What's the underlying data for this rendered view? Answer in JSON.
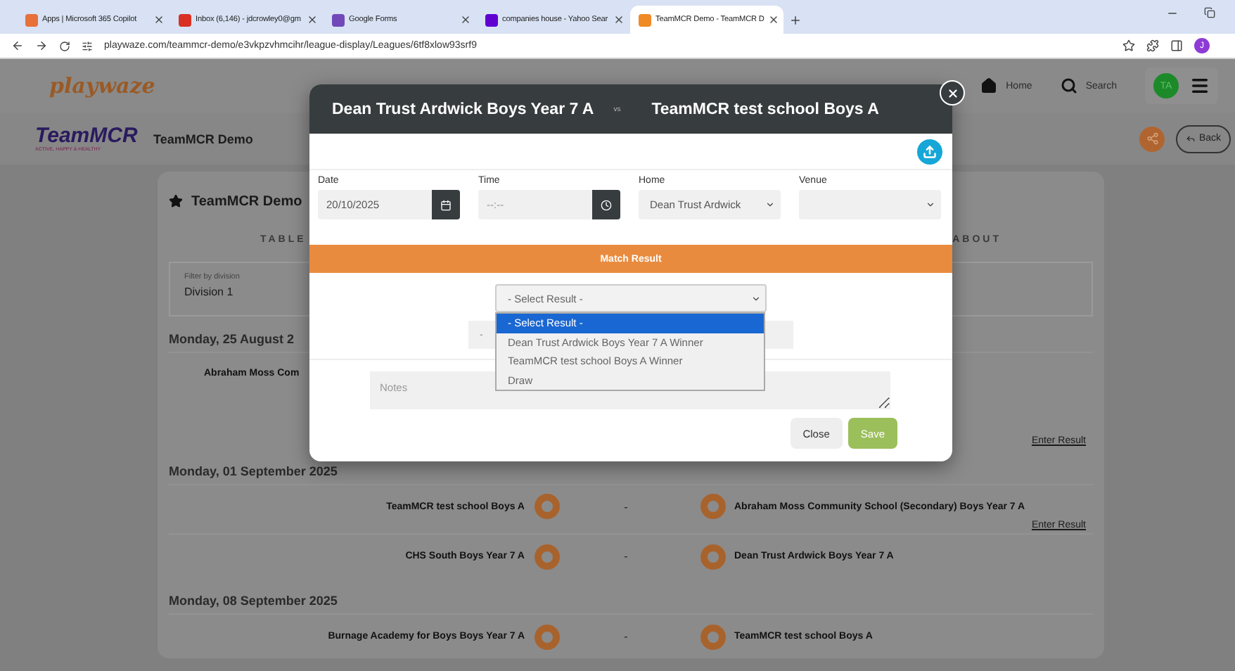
{
  "browser": {
    "tabs": [
      {
        "title": "Apps | Microsoft 365 Copilot",
        "color": "#e8703a",
        "selected": false
      },
      {
        "title": "Inbox (6,146) - jdcrowley0@gm",
        "color": "#d93025",
        "selected": false
      },
      {
        "title": "Google Forms",
        "color": "#7248b9",
        "selected": false
      },
      {
        "title": "companies house - Yahoo Sear",
        "color": "#6001d2",
        "selected": false
      },
      {
        "title": "TeamMCR Demo - TeamMCR D",
        "color": "#f08a24",
        "selected": true
      }
    ],
    "url": "playwaze.com/teammcr-demo/e3vkpzvhmcihr/league-display/Leagues/6tf8xlow93srf9",
    "profile": "J"
  },
  "site_header": {
    "logo": "playwaze",
    "nav": [
      {
        "kind": "home",
        "label": "Home"
      },
      {
        "kind": "search",
        "label": "Search"
      }
    ],
    "avatar": "TA"
  },
  "league_header": {
    "logo": "TeamMCR",
    "tagline": "ACTIVE, HAPPY & HEALTHY",
    "title": "TeamMCR Demo",
    "back": "Back"
  },
  "card": {
    "title": "TeamMCR Demo",
    "tabs": [
      {
        "label": "TABLE"
      },
      {
        "label": "ABOUT"
      }
    ],
    "filter": {
      "label": "Filter by division",
      "value": "Division 1"
    },
    "sections": [
      {
        "date": "Monday, 25 August 2",
        "fixtures": [
          {
            "kind": "covered",
            "home": "Abraham Moss Com"
          },
          {
            "kind": "covered",
            "link": "Enter Result"
          }
        ]
      },
      {
        "date": "Monday, 01 September 2025",
        "fixtures": [
          {
            "kind": "match",
            "home": "TeamMCR test school Boys A",
            "score": "-",
            "away": "Abraham Moss Community School (Secondary) Boys Year 7 A",
            "link": "Enter Result"
          },
          {
            "kind": "match",
            "home": "CHS South Boys Year 7 A",
            "score": "-",
            "away": "Dean Trust Ardwick Boys Year 7 A"
          }
        ]
      },
      {
        "date": "Monday, 08 September 2025",
        "fixtures": [
          {
            "kind": "match",
            "home": "Burnage Academy for Boys Boys Year 7 A",
            "score": "-",
            "away": "TeamMCR test school Boys A"
          }
        ]
      }
    ]
  },
  "modal": {
    "home_team": "Dean Trust Ardwick Boys Year 7 A",
    "vs": "vs",
    "away_team": "TeamMCR test school Boys A",
    "fields": [
      {
        "kind": "date",
        "label": "Date",
        "value": "20/10/2025"
      },
      {
        "kind": "time",
        "label": "Time",
        "placeholder": "--:--"
      },
      {
        "kind": "select",
        "label": "Home",
        "value": "Dean Trust Ardwick"
      },
      {
        "kind": "select",
        "label": "Venue"
      }
    ],
    "section_title": "Match Result",
    "result_select": {
      "value": "- Select Result -",
      "expanded": true,
      "options": [
        {
          "label": "- Select Result -",
          "selected": true
        },
        {
          "label": "Dean Trust Ardwick Boys Year 7 A Winner",
          "selected": false
        },
        {
          "label": "TeamMCR test school Boys A Winner",
          "selected": false
        },
        {
          "label": "Draw",
          "selected": false
        }
      ]
    },
    "score_row": {
      "text": "-"
    },
    "notes": {
      "placeholder": "Notes"
    },
    "buttons": [
      {
        "kind": "secondary",
        "label": "Close"
      },
      {
        "kind": "primary",
        "label": "Save"
      }
    ]
  }
}
